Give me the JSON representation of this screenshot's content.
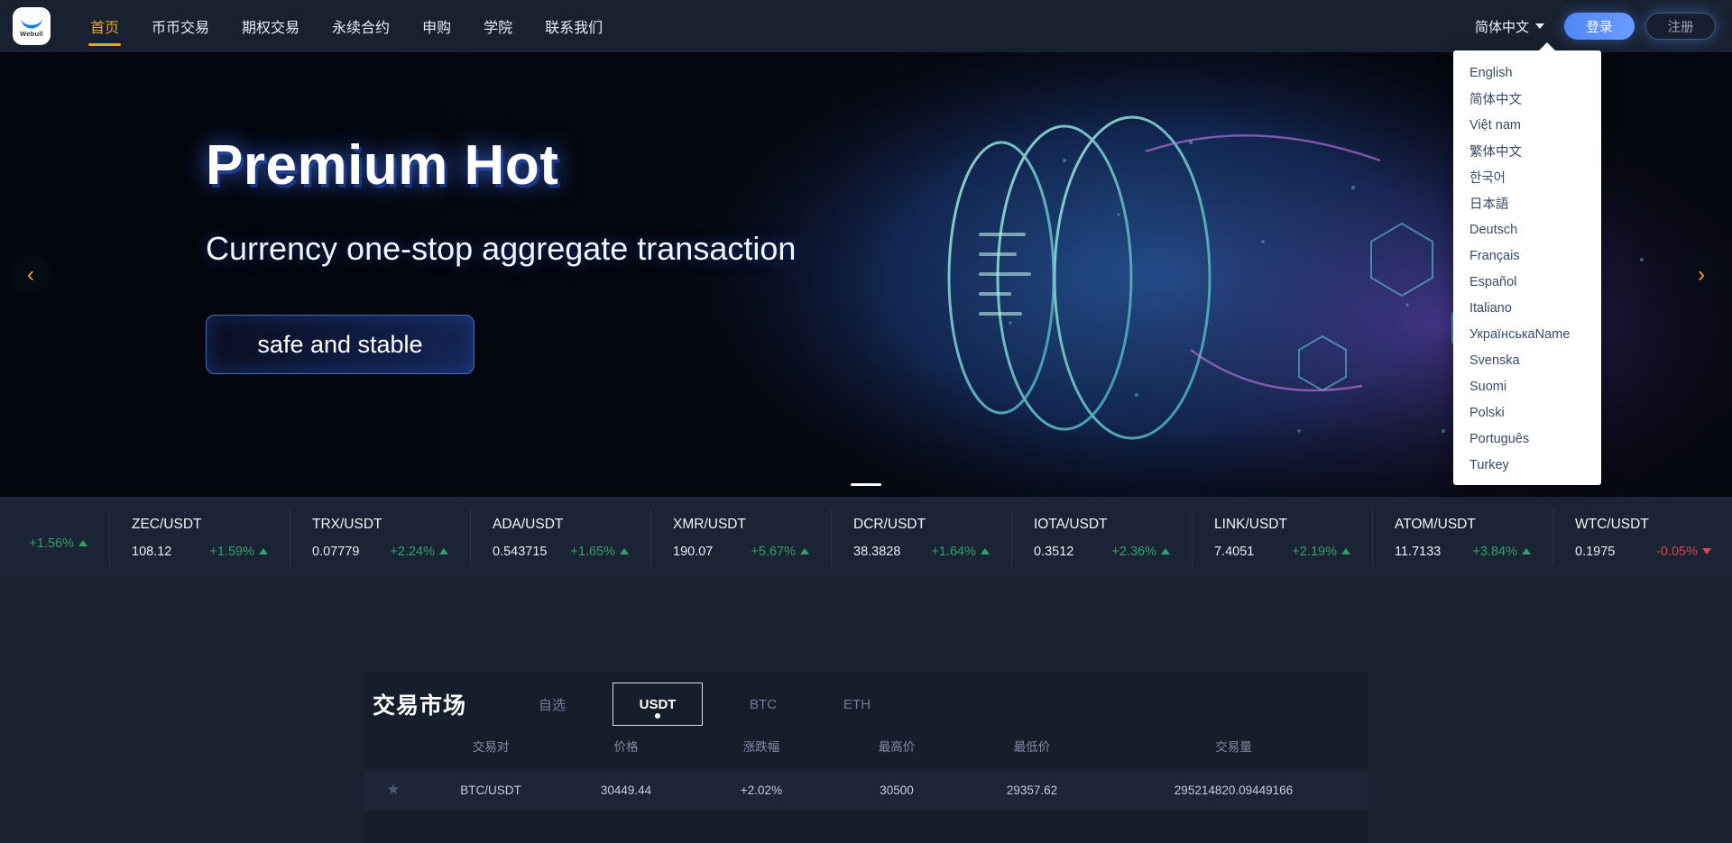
{
  "brand": {
    "name": "Webull",
    "logo_icon": "webull-bull-logo"
  },
  "nav": {
    "items": [
      {
        "label": "首页",
        "active": true
      },
      {
        "label": "币币交易",
        "active": false
      },
      {
        "label": "期权交易",
        "active": false
      },
      {
        "label": "永续合约",
        "active": false
      },
      {
        "label": "申购",
        "active": false
      },
      {
        "label": "学院",
        "active": false
      },
      {
        "label": "联系我们",
        "active": false
      }
    ],
    "language_current": "简体中文",
    "login_label": "登录",
    "register_label": "注册",
    "caret_icon": "chevron-down-icon",
    "accent_color": "#f0a021",
    "login_color": "#5f93fb"
  },
  "language_dropdown": {
    "open": true,
    "options": [
      "English",
      "简体中文",
      "Việt nam",
      "繁体中文",
      "한국어",
      "日本語",
      "Deutsch",
      "Français",
      "Español",
      "Italiano",
      "УкраїнськаName",
      "Svenska",
      "Suomi",
      "Polski",
      "Português",
      "Turkey"
    ]
  },
  "hero": {
    "title": "Premium Hot",
    "subtitle": "Currency one-stop aggregate transaction",
    "cta_label": "safe and stable",
    "prev_icon": "chevron-left-icon",
    "next_icon": "chevron-right-icon",
    "prev_glyph": "‹",
    "next_glyph": "›",
    "slide_count": 1,
    "active_slide": 1
  },
  "ticker": {
    "items": [
      {
        "pair": "",
        "price": "",
        "change": "+1.56%",
        "direction": "up",
        "partial": true
      },
      {
        "pair": "ZEC/USDT",
        "price": "108.12",
        "change": "+1.59%",
        "direction": "up"
      },
      {
        "pair": "TRX/USDT",
        "price": "0.07779",
        "change": "+2.24%",
        "direction": "up"
      },
      {
        "pair": "ADA/USDT",
        "price": "0.543715",
        "change": "+1.65%",
        "direction": "up"
      },
      {
        "pair": "XMR/USDT",
        "price": "190.07",
        "change": "+5.67%",
        "direction": "up"
      },
      {
        "pair": "DCR/USDT",
        "price": "38.3828",
        "change": "+1.64%",
        "direction": "up"
      },
      {
        "pair": "IOTA/USDT",
        "price": "0.3512",
        "change": "+2.36%",
        "direction": "up"
      },
      {
        "pair": "LINK/USDT",
        "price": "7.4051",
        "change": "+2.19%",
        "direction": "up"
      },
      {
        "pair": "ATOM/USDT",
        "price": "11.7133",
        "change": "+3.84%",
        "direction": "up"
      },
      {
        "pair": "WTC/USDT",
        "price": "0.1975",
        "change": "-0.05%",
        "direction": "down"
      }
    ],
    "up_color": "#31a06a",
    "down_color": "#d9444f"
  },
  "market": {
    "title": "交易市场",
    "tabs": [
      {
        "label": "自选",
        "selected": false
      },
      {
        "label": "USDT",
        "selected": true
      },
      {
        "label": "BTC",
        "selected": false
      },
      {
        "label": "ETH",
        "selected": false
      }
    ],
    "columns": [
      "交易对",
      "价格",
      "涨跌幅",
      "最高价",
      "最低价",
      "交易量"
    ],
    "rows": [
      {
        "favorite_icon": "star-icon",
        "pair": "BTC/USDT",
        "price": "30449.44",
        "change": "+2.02%",
        "high": "30500",
        "low": "29357.62",
        "volume": "295214820.09449166",
        "direction": "up"
      }
    ]
  }
}
